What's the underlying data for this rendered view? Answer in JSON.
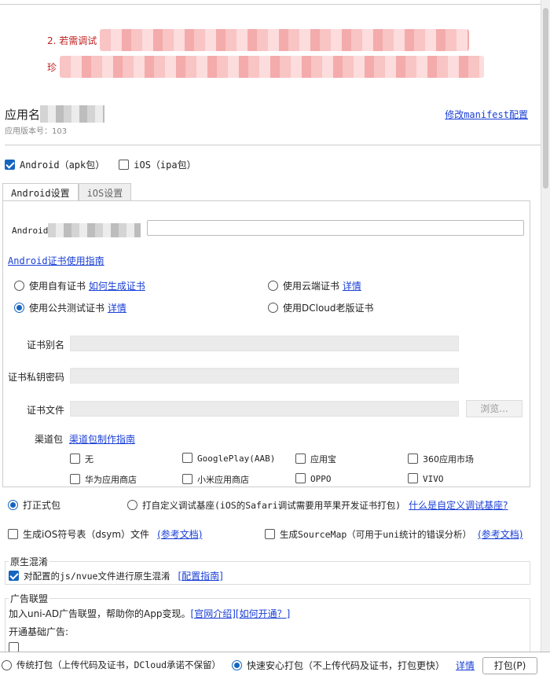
{
  "warning": {
    "line1_prefix": "2. 若需调试",
    "line2_prefix": "珍"
  },
  "app": {
    "name_label": "应用名",
    "version_label": "应用版本号：103",
    "manifest_link": "修改manifest配置"
  },
  "platforms": {
    "android": {
      "label": "Android（apk包）",
      "checked": true
    },
    "ios": {
      "label": "iOS（ipa包）",
      "checked": false
    }
  },
  "tabs": [
    {
      "label": "Android设置",
      "active": true
    },
    {
      "label": "iOS设置",
      "active": false
    }
  ],
  "android": {
    "package_label": "Android",
    "cert_guide": "Android证书使用指南",
    "cert_options": [
      {
        "label": "使用自有证书",
        "link": "如何生成证书",
        "checked": false
      },
      {
        "label": "使用云端证书",
        "link": "详情",
        "checked": false
      },
      {
        "label": "使用公共测试证书",
        "link": "详情",
        "checked": true
      },
      {
        "label": "使用DCloud老版证书",
        "link": "",
        "checked": false
      }
    ],
    "fields": {
      "alias": "证书别名",
      "password": "证书私钥密码",
      "file": "证书文件",
      "browse": "浏览..."
    },
    "channel": {
      "label": "渠道包",
      "guide": "渠道包制作指南",
      "options": [
        "无",
        "GooglePlay(AAB)",
        "应用宝",
        "360应用市场",
        "华为应用商店",
        "小米应用商店",
        "OPPO",
        "VIVO"
      ]
    }
  },
  "build_type": {
    "release": "打正式包",
    "custom_base": "打自定义调试基座(iOS的Safari调试需要用苹果开发证书打包)",
    "custom_link": "什么是自定义调试基座?"
  },
  "extras": {
    "dsym": "生成iOS符号表（dsym）文件",
    "dsym_link": "(参考文档)",
    "sourcemap": "生成SourceMap（可用于uni统计的错误分析）",
    "sourcemap_link": "(参考文档)"
  },
  "obfuscation": {
    "title": "原生混淆",
    "label": "对配置的js/nvue文件进行原生混淆",
    "link": "[配置指南]"
  },
  "ads": {
    "title": "广告联盟",
    "intro": "加入uni-AD广告联盟，帮助你的App变现。",
    "link1": "[官网介绍]",
    "link2": "[如何开通？]",
    "basic": "开通基础广告:"
  },
  "bottom": {
    "traditional": "传统打包（上传代码及证书，DCloud承诺不保留）",
    "fast": "快速安心打包（不上传代码及证书，打包更快）",
    "details": "详情",
    "build": "打包(P)"
  }
}
